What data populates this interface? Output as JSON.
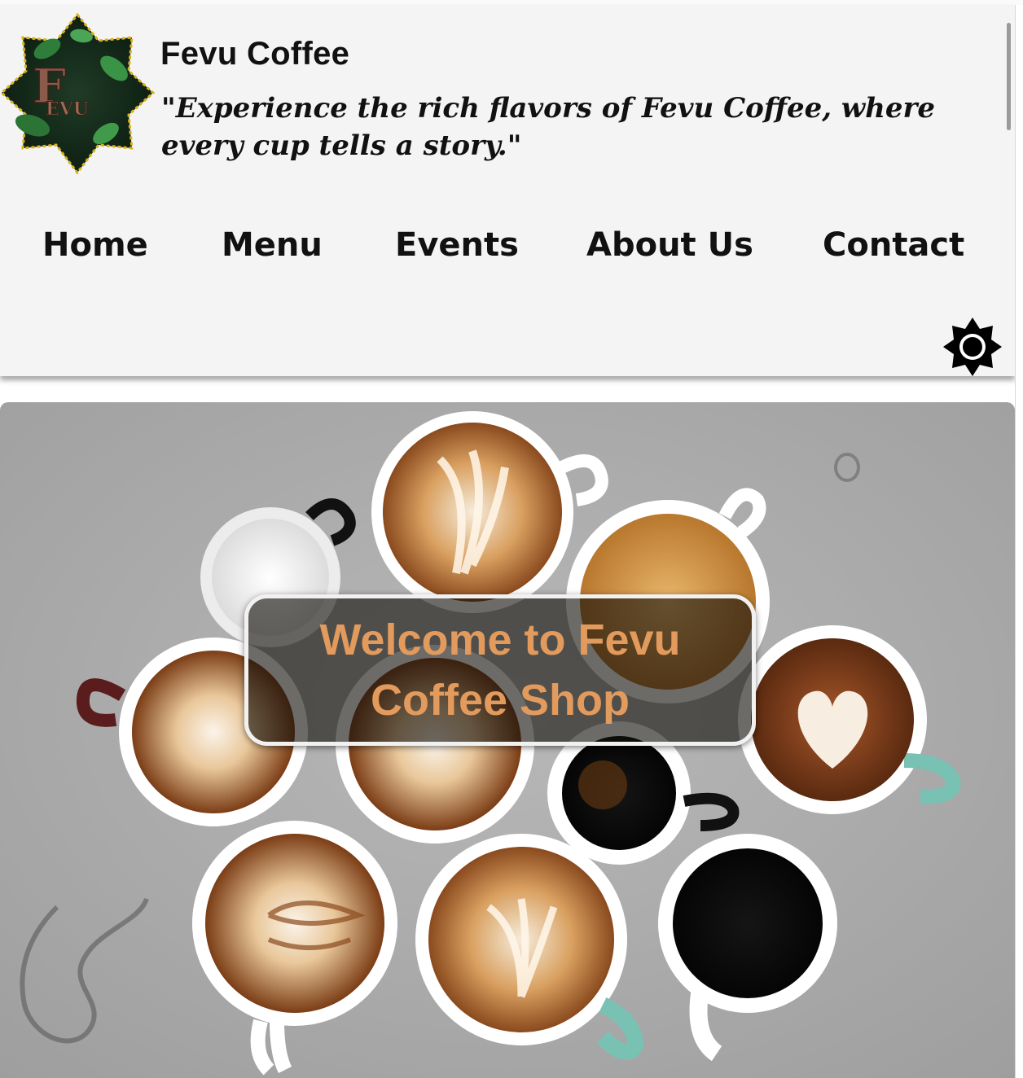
{
  "header": {
    "brand_name": "Fevu Coffee",
    "tagline": "\"Experience the rich flavors of Fevu Coffee, where every cup tells a story.\"",
    "logo_text": "FEVU"
  },
  "nav": {
    "items": [
      {
        "label": "Home"
      },
      {
        "label": "Menu"
      },
      {
        "label": "Events"
      },
      {
        "label": "About Us"
      },
      {
        "label": "Contact"
      }
    ]
  },
  "theme_toggle": {
    "icon": "sun-icon"
  },
  "hero": {
    "title": "Welcome to Fevu Coffee Shop",
    "image_alt": "Coffee cups with latte art on a concrete table"
  },
  "colors": {
    "header_bg": "#f4f4f4",
    "hero_title": "#e29a5d",
    "text": "#111111"
  }
}
